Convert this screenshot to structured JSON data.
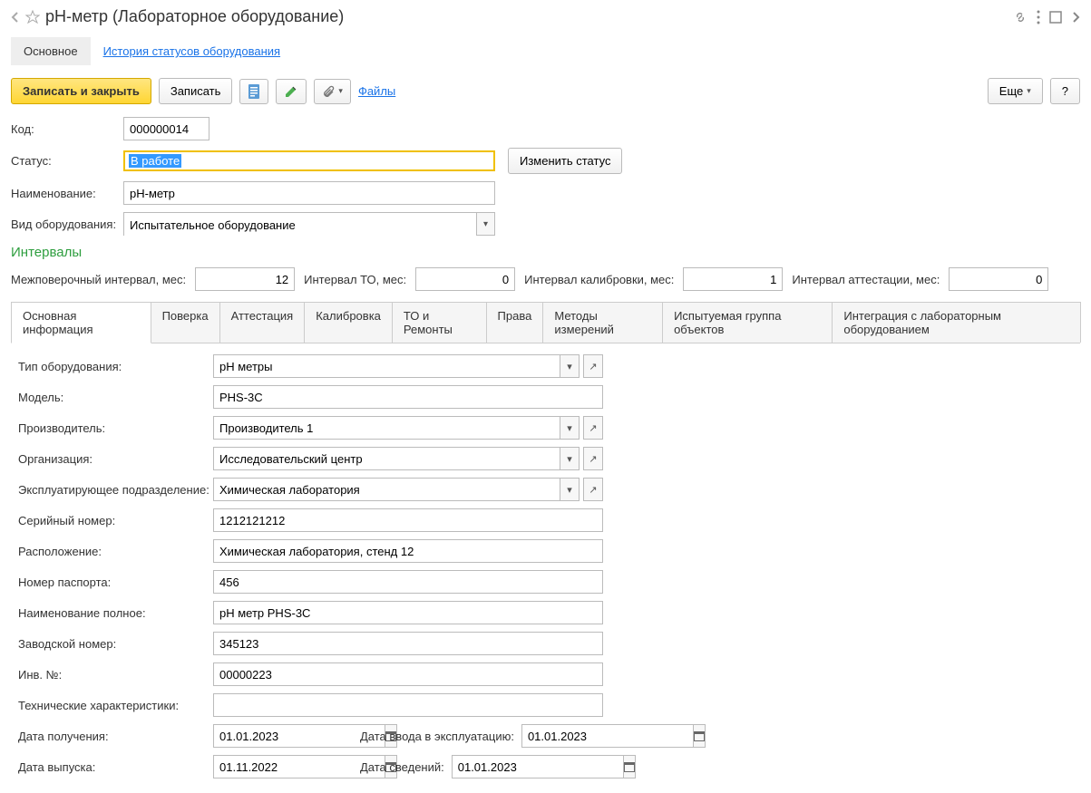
{
  "header": {
    "title": "pH-метр (Лабораторное оборудование)"
  },
  "nav": {
    "main": "Основное",
    "statusHistory": "История статусов оборудования"
  },
  "toolbar": {
    "writeAndClose": "Записать и закрыть",
    "write": "Записать",
    "files": "Файлы",
    "more": "Еще",
    "help": "?"
  },
  "fields": {
    "codeLabel": "Код:",
    "codeValue": "000000014",
    "statusLabel": "Статус:",
    "statusValue": "В работе",
    "changeStatus": "Изменить статус",
    "nameLabel": "Наименование:",
    "nameValue": "pH-метр",
    "equipTypeLabel": "Вид оборудования:",
    "equipTypeValue": "Испытательное оборудование"
  },
  "intervals": {
    "title": "Интервалы",
    "verificationLabel": "Межповерочный интервал, мес:",
    "verificationValue": "12",
    "maintenanceLabel": "Интервал ТО, мес:",
    "maintenanceValue": "0",
    "calibrationLabel": "Интервал калибровки, мес:",
    "calibrationValue": "1",
    "attestationLabel": "Интервал аттестации, мес:",
    "attestationValue": "0"
  },
  "subtabs": {
    "mainInfo": "Основная информация",
    "verification": "Поверка",
    "attestation": "Аттестация",
    "calibration": "Калибровка",
    "maintenance": "ТО и Ремонты",
    "rights": "Права",
    "methods": "Методы измерений",
    "testGroup": "Испытуемая группа объектов",
    "integration": "Интеграция с лабораторным оборудованием"
  },
  "details": {
    "equipTypeLabel": "Тип оборудования:",
    "equipTypeValue": "pH метры",
    "modelLabel": "Модель:",
    "modelValue": "PHS-3C",
    "manufacturerLabel": "Производитель:",
    "manufacturerValue": "Производитель 1",
    "orgLabel": "Организация:",
    "orgValue": "Исследовательский центр",
    "deptLabel": "Эксплуатирующее подразделение:",
    "deptValue": "Химическая лаборатория",
    "serialLabel": "Серийный номер:",
    "serialValue": "1212121212",
    "locationLabel": "Расположение:",
    "locationValue": "Химическая лаборатория, стенд 12",
    "passportLabel": "Номер паспорта:",
    "passportValue": "456",
    "fullNameLabel": "Наименование полное:",
    "fullNameValue": "pH метр PHS-3C",
    "factoryNumLabel": "Заводской номер:",
    "factoryNumValue": "345123",
    "invNumLabel": "Инв. №:",
    "invNumValue": "00000223",
    "techSpecLabel": "Технические характеристики:",
    "techSpecValue": "",
    "receiptDateLabel": "Дата получения:",
    "receiptDateValue": "01.01.2023",
    "commissionDateLabel": "Дата ввода в эксплуатацию:",
    "commissionDateValue": "01.01.2023",
    "releaseDateLabel": "Дата выпуска:",
    "releaseDateValue": "01.11.2022",
    "infoDateLabel": "Дата сведений:",
    "infoDateValue": "01.01.2023"
  }
}
